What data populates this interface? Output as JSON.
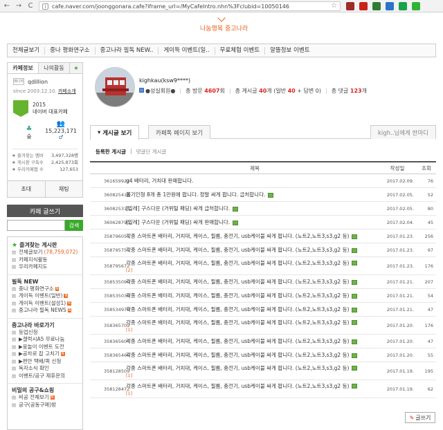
{
  "browser": {
    "back": "←",
    "forward": "→",
    "reload": "C",
    "url": "cafe.naver.com/joonggonara.cafe?iframe_url=/MyCafeIntro.nhn%3Fclubid=10050146"
  },
  "banner": {
    "link": "나눔행복 중고나라"
  },
  "menu": {
    "items": [
      "전체글보기",
      "중나 평화연구소",
      "중고나라 필독 NEW..",
      "게이득 이벤트(일..",
      "무료체험 이벤트",
      "알뜰정보 이벤트"
    ]
  },
  "sidebar": {
    "tabs": {
      "cafe_info": "카페정보",
      "my_activity": "나의활동",
      "star": "★"
    },
    "manager_badge": "매니저",
    "manager_name": "qdillion",
    "since": "since 2003.12.10.",
    "since_link": "카페소개",
    "badge_year": "2015",
    "badge_text": "네이버 대표카페",
    "level_label": "숲",
    "members": "15,223,171",
    "members_suffix": "♂",
    "stat_lines": [
      {
        "label": "즐겨찾는 멤버",
        "value": "3,497,328명"
      },
      {
        "label": "게시판 구독수",
        "value": "2,425,873회"
      },
      {
        "label": "우리카페앱 수",
        "value": "127,653"
      }
    ],
    "invite": "초대",
    "chat": "채팅",
    "write": "카페 글쓰기",
    "search_button": "검색",
    "boards": [
      {
        "type": "head",
        "label": "즐겨찾는 게시판",
        "star": true
      },
      {
        "type": "item",
        "label": "전체글보기",
        "count": "(78,759,072)"
      },
      {
        "type": "item",
        "label": "카페지식활동"
      },
      {
        "type": "item",
        "label": "우리카페지도"
      },
      {
        "type": "sep"
      },
      {
        "type": "head",
        "label": "필독 NEW"
      },
      {
        "type": "item",
        "label": "중나 평화연구소",
        "new": true
      },
      {
        "type": "item",
        "label": "게이득 이벤트(일반)",
        "new": true
      },
      {
        "type": "item",
        "label": "게이득 이벤트(설성1)",
        "new": true
      },
      {
        "type": "item",
        "label": "중고나라 필독 NEWS",
        "new": true
      },
      {
        "type": "sep"
      },
      {
        "type": "head",
        "label": "중고나라 바로가기"
      },
      {
        "type": "item",
        "label": "등업신청"
      },
      {
        "type": "item",
        "label": "▶갤럭시A5 무료나눔"
      },
      {
        "type": "item",
        "label": "▶웅놀이 이벤트 도전"
      },
      {
        "type": "item",
        "label": "▶공차로 잡 고치기",
        "new": true
      },
      {
        "type": "item",
        "label": "▶편안 택배/퀵 신청"
      },
      {
        "type": "item",
        "label": "독자소식 확인"
      },
      {
        "type": "item",
        "label": "이벤트/공구 제휴문의"
      },
      {
        "type": "sep"
      },
      {
        "type": "head",
        "label": "비밀의 공구&쇼핑"
      },
      {
        "type": "item",
        "label": "비공 전체보기",
        "new": true
      },
      {
        "type": "item",
        "label": "공구(공동구매)방"
      }
    ]
  },
  "profile": {
    "name": "kighkau(ksw9****)",
    "level": "●성실회원●",
    "visits_label": "총 방문",
    "visits": "4607",
    "visits_unit": "회",
    "posts_label": "총 게시글",
    "posts": "40",
    "posts_unit": "개 (일반",
    "posts_normal": "40",
    "posts_plus": "+ 답변",
    "posts_reply": "0",
    "posts_end": ")",
    "comments_label": "총 댓글",
    "comments": "123",
    "comments_unit": "개"
  },
  "tabs": {
    "posts": "게시글 보기",
    "page": "카페톡 페이지 보기",
    "message": "kigh..님에게 한마디"
  },
  "subtabs": {
    "written": "등록한 게시글",
    "sep": "|",
    "commented": "댓글단 게시글"
  },
  "table": {
    "headers": {
      "title": "제목",
      "date": "작성일",
      "views": "조회"
    },
    "rows": [
      {
        "id": "361659922",
        "title": "g4 배터리, 거치대 판매합니다.",
        "date": "2017.02.09.",
        "views": "76",
        "img": false
      },
      {
        "id": "360825414",
        "title": "뽑기인형 8개 총 1만원에 팝니다. 정말 싸게 팝니다. 급처합니다.",
        "date": "2017.02.05.",
        "views": "52",
        "img": true
      },
      {
        "id": "360825315",
        "title": "[밀레] 구스다운 (거위털 패딩) 싸게 급처합니다.",
        "date": "2017.02.05.",
        "views": "80",
        "img": true
      },
      {
        "id": "360628790",
        "title": "[밀레] 구스다운 (거위털 패딩) 싸게 판매합니다.",
        "date": "2017.02.04.",
        "views": "45",
        "img": true
      },
      {
        "id": "358796051",
        "title": "각종 스마트폰 배터리, 거치대, 케이스, 필름, 충전기, usb케이블 싸게 팝니다. (노트2,노트3,s3,g2 등)",
        "date": "2017.01.23.",
        "views": "256",
        "img": true
      },
      {
        "id": "358795751",
        "title": "각종 스마트폰 배터리, 거치대, 케이스, 필름, 충전기, usb케이블 싸게 팝니다. (노트2,노트3,s3,g2 등)",
        "date": "2017.01.23.",
        "views": "97",
        "img": true
      },
      {
        "id": "358795672",
        "title": "각종 스마트폰 배터리, 거치대, 케이스, 필름, 충전기, usb케이블 싸게 팝니다. (노트2,노트3,s3,g2 등)",
        "comments": "[2]",
        "date": "2017.01.23.",
        "views": "176",
        "img": true
      },
      {
        "id": "358535090",
        "title": "각종 스마트폰 배터리, 거치대, 케이스, 필름, 충전기, usb케이블 싸게 팝니다. (노트2,노트3,s3,g2 등)",
        "date": "2017.01.21.",
        "views": "207",
        "img": true
      },
      {
        "id": "358535038",
        "title": "각종 스마트폰 배터리, 거치대, 케이스, 필름, 충전기, usb케이블 싸게 팝니다. (노트2,노트3,s3,g2 등)",
        "date": "2017.01.21.",
        "views": "54",
        "img": true
      },
      {
        "id": "358534979",
        "title": "각종 스마트폰 배터리, 거치대, 케이스, 필름, 충전기, usb케이블 싸게 팝니다. (노트2,노트3,s3,g2 등)",
        "date": "2017.01.21.",
        "views": "47",
        "img": true
      },
      {
        "id": "358365709",
        "title": "각종 스마트폰 배터리, 거치대, 케이스, 필름, 충전기, usb케이블 싸게 팝니다. (노트2,노트3,s3,g2 등)",
        "comments": "[1]",
        "date": "2017.01.20.",
        "views": "176",
        "img": true
      },
      {
        "id": "358365604",
        "title": "각종 스마트폰 배터리, 거치대, 케이스, 필름, 충전기, usb케이블 싸게 팝니다. (노트2,노트3,s3,g2 등)",
        "date": "2017.01.20.",
        "views": "47",
        "img": true
      },
      {
        "id": "358365466",
        "title": "각종 스마트폰 배터리, 거치대, 케이스, 필름, 충전기, usb케이블 싸게 팝니다. (노트2,노트3,s3,g2 등)",
        "date": "2017.01.20.",
        "views": "55",
        "img": true
      },
      {
        "id": "358128509",
        "title": "각종 스마트폰 배터리, 거치대, 케이스, 필름, 충전기, usb케이블 싸게 팝니다. (노트2,노트3,s3,g2 등)",
        "comments": "[1]",
        "date": "2017.01.19.",
        "views": "195",
        "img": true
      },
      {
        "id": "358128472",
        "title": "각종 스마트폰 배터리, 거치대, 케이스, 필름, 충전기, usb케이블 싸게 팝니다. (노트2,노트3,s3,g2 등)",
        "comments": "[1]",
        "date": "2017.01.19.",
        "views": "62",
        "img": true
      }
    ]
  },
  "write_button": "글쓰기",
  "colors": {
    "accent": "#e8601c",
    "green": "#3aa92a",
    "red": "#e02020"
  }
}
